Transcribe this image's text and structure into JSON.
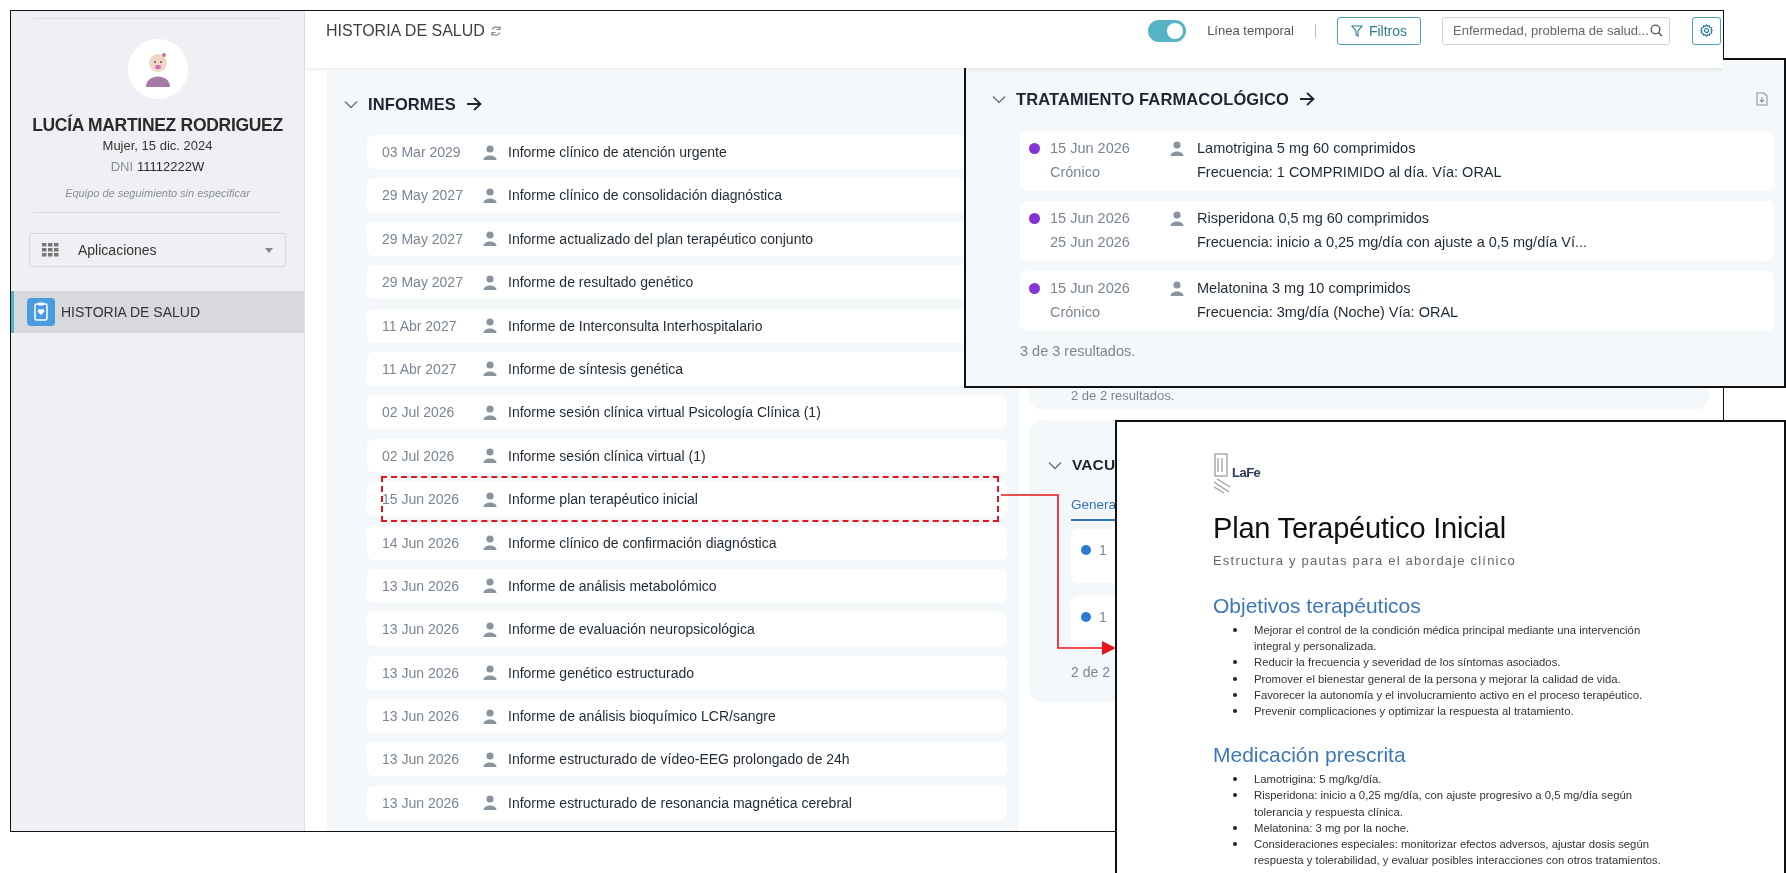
{
  "sidebar": {
    "patient_name": "LUCÍA MARTINEZ RODRIGUEZ",
    "patient_info": "Mujer, 15 dic. 2024",
    "id_label": "DNI",
    "id_value": "11112222W",
    "team_note": "Equipo de seguimiento sin especificar",
    "apps_dropdown": "Aplicaciones",
    "nav_items": [
      {
        "label": "HISTORIA DE SALUD",
        "selected": true
      }
    ]
  },
  "header": {
    "title": "HISTORIA DE SALUD",
    "timeline_toggle": {
      "label": "Línea temporal",
      "on": true
    },
    "filters_button": "Filtros",
    "search": {
      "placeholder": "Enfermedad, problema de salud..."
    }
  },
  "reports": {
    "title": "INFORMES",
    "expanded": true,
    "rows": [
      {
        "date": "03 Mar 2029",
        "title": "Informe clínico de atención urgente",
        "highlighted": false
      },
      {
        "date": "29 May 2027",
        "title": "Informe clínico de consolidación diagnóstica",
        "highlighted": false
      },
      {
        "date": "29 May 2027",
        "title": "Informe actualizado del plan terapéutico conjunto",
        "highlighted": false
      },
      {
        "date": "29 May 2027",
        "title": "Informe de resultado genético",
        "highlighted": false
      },
      {
        "date": "11 Abr 2027",
        "title": "Informe de Interconsulta Interhospitalario",
        "highlighted": false
      },
      {
        "date": "11 Abr 2027",
        "title": "Informe de síntesis genética",
        "highlighted": false
      },
      {
        "date": "02 Jul 2026",
        "title": "Informe sesión clínica virtual Psicología Clínica (1)",
        "highlighted": false
      },
      {
        "date": "02 Jul 2026",
        "title": "Informe sesión clínica virtual (1)",
        "highlighted": false
      },
      {
        "date": "15 Jun 2026",
        "title": "Informe plan terapéutico inicial",
        "highlighted": true
      },
      {
        "date": "14 Jun 2026",
        "title": "Informe clínico de confirmación diagnóstica",
        "highlighted": false
      },
      {
        "date": "13 Jun 2026",
        "title": "Informe de análisis metabolómico",
        "highlighted": false
      },
      {
        "date": "13 Jun 2026",
        "title": "Informe de evaluación neuropsicológica",
        "highlighted": false
      },
      {
        "date": "13 Jun 2026",
        "title": "Informe genético estructurado",
        "highlighted": false
      },
      {
        "date": "13 Jun 2026",
        "title": "Informe de análisis bioquímico LCR/sangre",
        "highlighted": false
      },
      {
        "date": "13 Jun 2026",
        "title": "Informe estructurado de vídeo-EEG prolongado de 24h",
        "highlighted": false
      },
      {
        "date": "13 Jun 2026",
        "title": "Informe estructurado de resonancia magnética cerebral",
        "highlighted": false
      }
    ]
  },
  "background_panel": {
    "footer": "2 de 2 resultados."
  },
  "vaccines": {
    "title": "VACU",
    "expanded": true,
    "tabs": [
      {
        "label": "Genera",
        "selected": true
      }
    ],
    "rows": [
      {
        "text": "1",
        "color": "#2e78d2"
      },
      {
        "text": "1",
        "color": "#2e78d2"
      }
    ],
    "footer": "2 de 2"
  },
  "treatment": {
    "title": "TRATAMIENTO FARMACOLÓGICO",
    "expanded": true,
    "rows": [
      {
        "color": "#8234d4",
        "date": "15 Jun 2026",
        "end": "Crónico",
        "name": "Lamotrigina 5 mg 60 comprimidos",
        "frequency": "Frecuencia: 1 COMPRIMIDO al día. Vía: ORAL"
      },
      {
        "color": "#8234d4",
        "date": "15 Jun 2026",
        "end": "25 Jun 2026",
        "name": "Risperidona 0,5 mg 60 comprimidos",
        "frequency": "Frecuencia: inicio a 0,25 mg/día con ajuste a 0,5 mg/día Ví..."
      },
      {
        "color": "#8234d4",
        "date": "15 Jun 2026",
        "end": "Crónico",
        "name": "Melatonina 3 mg 10 comprimidos",
        "frequency": "Frecuencia: 3mg/día (Noche) Vía: ORAL"
      }
    ],
    "footer": "3 de 3 resultados."
  },
  "document": {
    "logo_text": "LaFe",
    "title": "Plan Terapéutico Inicial",
    "subtitle": "Estructura y pautas para el abordaje clínico",
    "sections": [
      {
        "heading": "Objetivos terapéuticos",
        "items": [
          "Mejorar el control de la condición médica principal mediante una intervención integral y personalizada.",
          "Reducir la frecuencia y severidad de los síntomas asociados.",
          "Promover el bienestar general de la persona y mejorar la calidad de vida.",
          "Favorecer la autonomía y el involucramiento activo en el proceso terapéutico.",
          "Prevenir complicaciones y optimizar la respuesta al tratamiento."
        ]
      },
      {
        "heading": "Medicación prescrita",
        "items": [
          "Lamotrigina: 5 mg/kg/día.",
          "Risperidona: inicio a 0,25 mg/día, con ajuste progresivo a 0,5 mg/día según tolerancia y respuesta clínica.",
          "Melatonina: 3 mg por la noche.",
          "Consideraciones especiales: monitorizar efectos adversos, ajustar dosis según respuesta y tolerabilidad, y evaluar posibles interacciones con otros tratamientos."
        ]
      }
    ]
  }
}
